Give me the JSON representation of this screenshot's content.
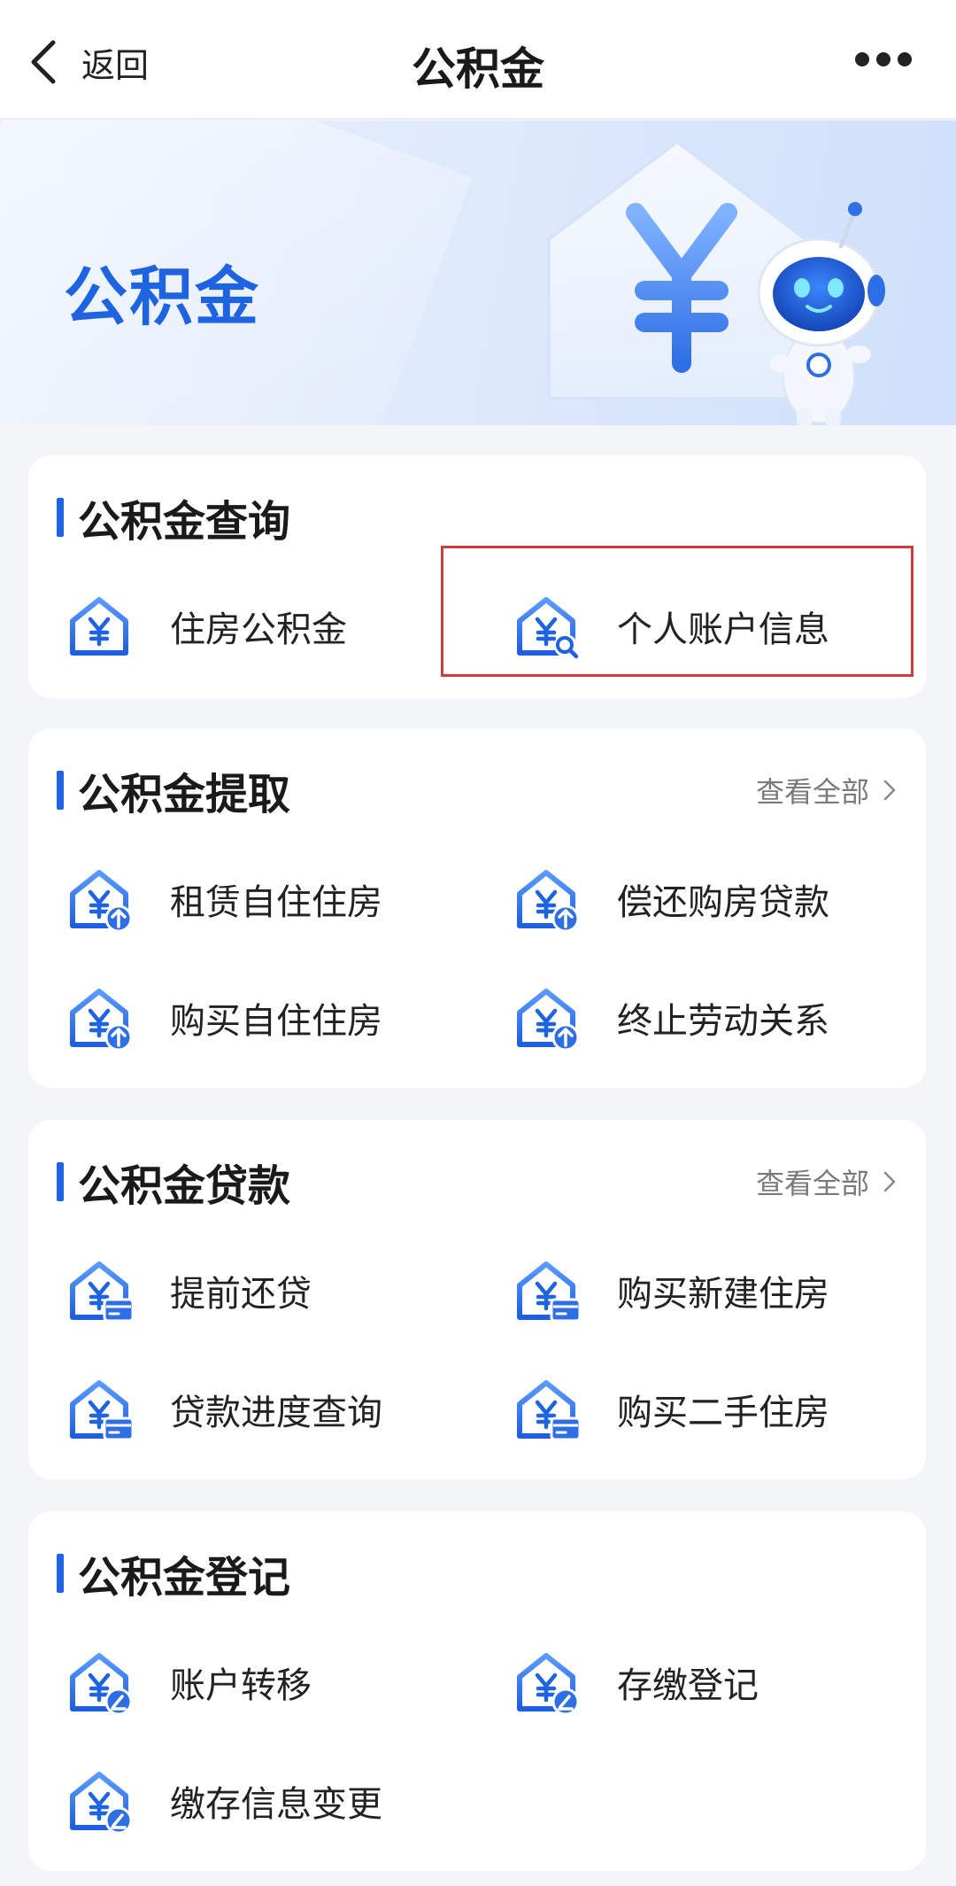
{
  "navbar": {
    "back_label": "返回",
    "title": "公积金",
    "back_icon": "chevron-left-icon",
    "more_icon": "more-dots-icon"
  },
  "banner": {
    "title": "公积金",
    "illustration": "house-yuan-robot-illustration"
  },
  "colors": {
    "accent": "#1e63e0",
    "highlight": "#d23b3b",
    "background": "#f3f5f9"
  },
  "sections": [
    {
      "title": "公积金查询",
      "more_label": "",
      "items": [
        {
          "label": "住房公积金",
          "icon": "house-yuan-icon"
        },
        {
          "label": "个人账户信息",
          "icon": "house-yuan-search-icon",
          "highlighted": true
        }
      ]
    },
    {
      "title": "公积金提取",
      "more_label": "查看全部",
      "items": [
        {
          "label": "租赁自住住房",
          "icon": "house-yuan-upload-icon"
        },
        {
          "label": "偿还购房贷款",
          "icon": "house-yuan-upload-icon"
        },
        {
          "label": "购买自住住房",
          "icon": "house-yuan-upload-icon"
        },
        {
          "label": "终止劳动关系",
          "icon": "house-yuan-upload-icon"
        }
      ]
    },
    {
      "title": "公积金贷款",
      "more_label": "查看全部",
      "items": [
        {
          "label": "提前还贷",
          "icon": "house-yuan-card-icon"
        },
        {
          "label": "购买新建住房",
          "icon": "house-yuan-card-icon"
        },
        {
          "label": "贷款进度查询",
          "icon": "house-yuan-card-icon"
        },
        {
          "label": "购买二手住房",
          "icon": "house-yuan-card-icon"
        }
      ]
    },
    {
      "title": "公积金登记",
      "more_label": "",
      "items": [
        {
          "label": "账户转移",
          "icon": "house-yuan-edit-icon"
        },
        {
          "label": "存缴登记",
          "icon": "house-yuan-edit-icon"
        },
        {
          "label": "缴存信息变更",
          "icon": "house-yuan-edit-icon"
        }
      ]
    }
  ]
}
